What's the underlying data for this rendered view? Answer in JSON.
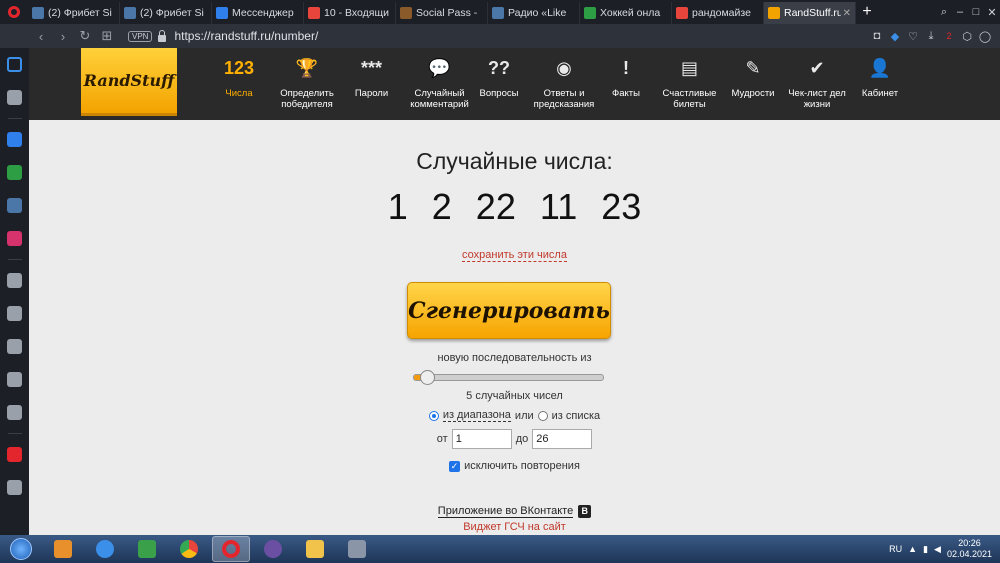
{
  "browser": {
    "tabs": [
      {
        "title": "(2) Фрибет Si",
        "icon_color": "#4a76a8",
        "active": false
      },
      {
        "title": "(2) Фрибет Si",
        "icon_color": "#4a76a8",
        "active": false
      },
      {
        "title": "Мессенджер",
        "icon_color": "#2f80ed",
        "active": false
      },
      {
        "title": "10 - Входящи",
        "icon_color": "#e8453c",
        "active": false
      },
      {
        "title": "Social Pass -",
        "icon_color": "#8b5a2b",
        "active": false
      },
      {
        "title": "Радио «Like",
        "icon_color": "#4a76a8",
        "active": false
      },
      {
        "title": "Хоккей онла",
        "icon_color": "#2e9e44",
        "active": false
      },
      {
        "title": "рандомайзе",
        "icon_color": "#e8453c",
        "active": false
      },
      {
        "title": "RandStuff.ru",
        "icon_color": "#f3a300",
        "active": true
      }
    ],
    "new_tab": "+",
    "vpn_label": "VPN",
    "url": "https://randstuff.ru/number/",
    "ext_badge": "2"
  },
  "sidebar": {
    "items": [
      "home-icon",
      "bookmarks-icon",
      "messenger-icon",
      "whatsapp-icon",
      "vk-icon",
      "instagram-icon",
      "player-icon",
      "heart-icon",
      "history-icon",
      "settings-icon",
      "lightbulb-icon",
      "opera-icon",
      "more-icon"
    ]
  },
  "site": {
    "logo": "RandStuff",
    "nav": [
      {
        "icon": "123",
        "label": "Числа",
        "active": true
      },
      {
        "icon": "🏆",
        "label": "Определить победителя",
        "active": false
      },
      {
        "icon": "***",
        "label": "Пароли",
        "active": false
      },
      {
        "icon": "💬",
        "label": "Случайный комментарий",
        "active": false
      },
      {
        "icon": "??",
        "label": "Вопросы",
        "active": false
      },
      {
        "icon": "◉",
        "label": "Ответы и предсказания",
        "active": false
      },
      {
        "icon": "!",
        "label": "Факты",
        "active": false
      },
      {
        "icon": "▤",
        "label": "Счастливые билеты",
        "active": false
      },
      {
        "icon": "✎",
        "label": "Мудрости",
        "active": false
      },
      {
        "icon": "✔",
        "label": "Чек-лист дел жизни",
        "active": false
      },
      {
        "icon": "👤",
        "label": "Кабинет",
        "active": false
      }
    ]
  },
  "main": {
    "heading": "Случайные числа:",
    "numbers": [
      "1",
      "2",
      "22",
      "11",
      "23"
    ],
    "save_link": "сохранить эти числа",
    "generate_button": "Сгенерировать",
    "sequence_label": "новую последовательность из",
    "slider_value_fraction": 0.08,
    "count_label": "5 случайных чисел",
    "mode_range": "из диапазона",
    "mode_or": "или",
    "mode_list": "из списка",
    "from_label": "от",
    "from_value": "1",
    "to_label": "до",
    "to_value": "26",
    "exclude_label": "исключить повторения",
    "vk_app_link": "Приложение во ВКонтакте",
    "vk_badge": "B",
    "widget_link": "Виджет ГСЧ на сайт"
  },
  "taskbar": {
    "time": "20:26",
    "date": "02.04.2021",
    "lang": "RU"
  }
}
